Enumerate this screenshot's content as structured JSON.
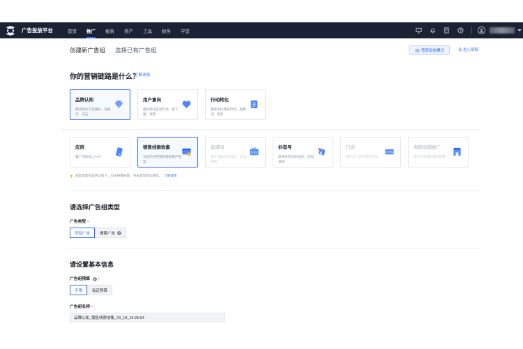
{
  "nav": {
    "brand": "广告投放平台",
    "items": [
      {
        "label": "首页",
        "active": false
      },
      {
        "label": "推广",
        "active": true
      },
      {
        "label": "报表",
        "active": false
      },
      {
        "label": "资产",
        "active": false
      },
      {
        "label": "工具",
        "active": false
      },
      {
        "label": "财务",
        "active": false
      },
      {
        "label": "学堂",
        "active": false
      }
    ],
    "icons": [
      "monitor-icon",
      "bell-icon",
      "document-icon",
      "help-icon",
      "user-icon"
    ]
  },
  "tabs": {
    "create": "创建新广告组",
    "select_existing": "选择已有广告组"
  },
  "header_actions": {
    "manager_mode": "管家投放模式",
    "enter_draft": "进入草稿"
  },
  "marketing": {
    "question": "你的营销链路是什么？",
    "detail_link": "了解详情",
    "row1": [
      {
        "title": "品牌认知",
        "desc": "最优优化产品曝光、加展示、点击",
        "icon": "diamond-icon",
        "state": "selected"
      },
      {
        "title": "用户意向",
        "desc": "最优优化互动行为、留下载、点赞",
        "icon": "heart-icon",
        "state": "normal"
      },
      {
        "title": "行动转化",
        "desc": "最优优化转化行为、加激活、购买",
        "icon": "clipboard-icon",
        "state": "normal"
      }
    ],
    "row2": [
      {
        "title": "应用",
        "desc": "推广您的线上APP",
        "icon": "phone-icon",
        "state": "normal"
      },
      {
        "title": "销售线索收集",
        "desc": "为您的主营销售线索用户提案",
        "icon": "form-icon",
        "state": "selected"
      },
      {
        "title": "直播间",
        "desc": "提升直播间的访问、互动、转粉",
        "icon": "live-icon",
        "state": "disabled"
      },
      {
        "title": "抖音号",
        "desc": "提升抖音号的访问、互动、涨粉",
        "icon": "music-icon",
        "state": "normal"
      },
      {
        "title": "门店",
        "desc": "提升您门店的到店客流",
        "icon": "store-icon",
        "state": "disabled"
      },
      {
        "title": "电商店铺推广",
        "desc": "提升您店铺的电商销量",
        "icon": "shop-icon",
        "state": "disabled"
      }
    ],
    "tip": "线索收集在品牌认知下，可支持曝光量、点击量等优化目标。",
    "tip_link": "了解详情"
  },
  "ad_type": {
    "section_title": "请选择广告组类型",
    "label": "广告类型",
    "options": [
      {
        "label": "所有广告",
        "active": true
      },
      {
        "label": "搜索广告",
        "active": false
      }
    ]
  },
  "basic_info": {
    "section_title": "请设置基本信息",
    "budget_label": "广告组预算",
    "budget_options": [
      {
        "label": "不限",
        "active": true
      },
      {
        "label": "指定预算",
        "active": false
      }
    ],
    "name_label": "广告组名称",
    "name_value": "品牌认知_销售线索收集_03_18_16:25:54"
  },
  "colors": {
    "accent": "#3370ff",
    "topbar": "#1a2233",
    "required": "#f54a45"
  }
}
